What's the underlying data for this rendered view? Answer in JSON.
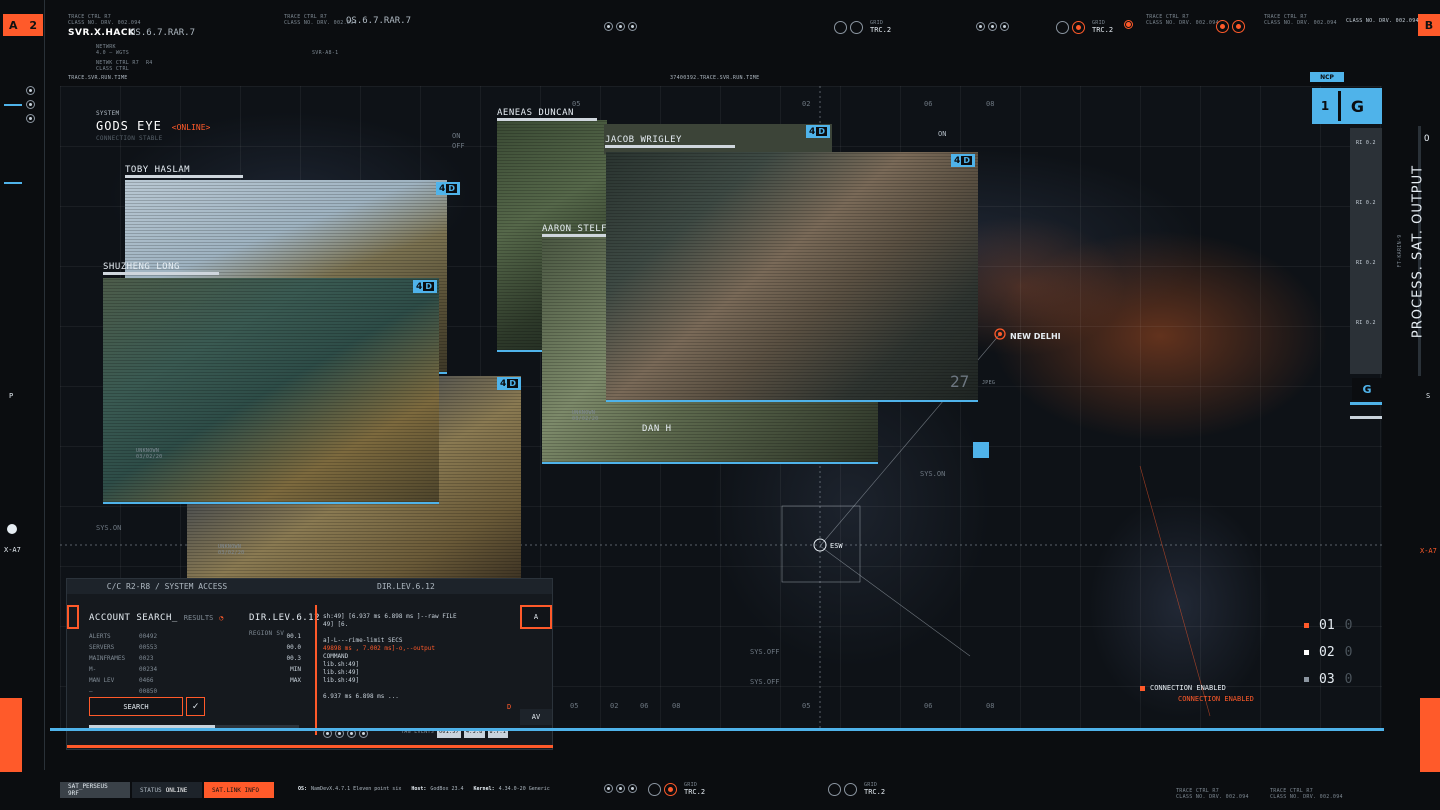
{
  "top": {
    "corner_left": {
      "letter": "A",
      "num": "2"
    },
    "corner_right": "B",
    "trace_label": "TRACE CTRL R7",
    "class_label": "CLASS NO. DRV. 002.094",
    "title": "SVR.X.HACK",
    "version": "OS.6.7.RAR.7",
    "version2": "OS.6.7.RAR.7",
    "network": "NETWRK",
    "network_val": "4.0 — WGTS",
    "netwrk_ctrl": "NETWK CTRL R7",
    "class_ctrl": "CLASS CTRL",
    "r4": "R4",
    "run_time_left": "TRACE.SVR.RUN.TIME",
    "run_time_center": "37400392.TRACE.SVR.RUN.TIME",
    "trc1": "TRC.2",
    "trc2": "TRC.2",
    "grid_label": "GRID",
    "code_tag": "SVR-A8-1"
  },
  "left_rail": {
    "p": "P",
    "xa7": "X-A7",
    "bottom_tag": "TRACE CTRL R7 CLASS NO. DRV. 002.094"
  },
  "right_rail": {
    "ncp": "NCP",
    "one": "1",
    "g": "G",
    "g2": "G",
    "ri": [
      "RI 0.2",
      "RI 0.2",
      "RI 0.2",
      "RI 0.2"
    ],
    "vertical": "PROCESS. SAT. OUTPUT",
    "vertical_small": "FT-KARIN-9",
    "s": "S",
    "xa7": "X-A7",
    "o": "O"
  },
  "system": {
    "label": "SYSTEM",
    "name": "GODS EYE",
    "status": "<ONLINE>",
    "conn": "CONNECTION STABLE"
  },
  "people": [
    {
      "name": "TOBY HASLAM",
      "n": "4",
      "d": "D"
    },
    {
      "name": "SHUZHENG LONG",
      "n": "4",
      "d": "D"
    },
    {
      "name": "AENEAS DUNCAN",
      "n": "4",
      "d": "D"
    },
    {
      "name": "JACOB WRIGLEY",
      "n": "4",
      "d": "D"
    },
    {
      "name": "AARON STELFOX",
      "n": "4",
      "d": "D"
    },
    {
      "name": "DAN H",
      "n": "4",
      "d": "D"
    }
  ],
  "map": {
    "city": "NEW DELHI",
    "esw": "ESW",
    "sys_on": "SYS.ON",
    "sys_off": "SYS.OFF",
    "on": "ON",
    "off": "OFF",
    "top_ticks": [
      "05",
      "02",
      "06",
      "08"
    ],
    "bottom_ticks": [
      "05",
      "02",
      "06",
      "08",
      "05",
      "06",
      "08"
    ],
    "number_27": "27",
    "jpeg": "JPEG",
    "unknown": "UNKNOWN",
    "date": "03/02/20",
    "conn_enabled": "CONNECTION ENABLED",
    "conn_enabled2": "CONNECTION ENABLED"
  },
  "legend": [
    {
      "num": "01",
      "ghost": "0"
    },
    {
      "num": "02",
      "ghost": "0"
    },
    {
      "num": "03",
      "ghost": "0"
    }
  ],
  "search": {
    "tab1": "C/C R2-R8 / SYSTEM ACCESS",
    "tab2": "DIR.LEV.6.12",
    "title": "ACCOUNT SEARCH_",
    "results": "RESULTS",
    "dir": "DIR.LEV.6.12",
    "region": "REGION SV",
    "stats": [
      {
        "k": "ALERTS",
        "m": "00492",
        "v": "00.1"
      },
      {
        "k": "SERVERS",
        "m": "00553",
        "v": "00.0"
      },
      {
        "k": "MAINFRAMES",
        "m": "0023",
        "v": "00.3"
      },
      {
        "k": "M-",
        "m": "00234",
        "v": "MIN"
      },
      {
        "k": "MAN LEV",
        "m": "0466",
        "v": "MAX"
      },
      {
        "k": "—",
        "m": "00850",
        "v": ""
      }
    ],
    "button": "SEARCH",
    "check": "✓",
    "log": [
      "sh:49] [6.937 ms 6.898 ms ]--raw FILE",
      "49] [6.",
      "",
      "a]-L---rime-limit SECS",
      "49898 ms , 7.002 ms]-o,--output",
      "COMMAND",
      "lib.sh:49]",
      "lib.sh:49]",
      "lib.sh:49]",
      "",
      "6.937 ms 6.898 ms ..."
    ],
    "side_a": "A",
    "side_av": "AV",
    "side_d": "D",
    "footer_tags": [
      "TAG EVENTS",
      "001.57",
      "4.3.8",
      "8.7.1"
    ]
  },
  "bottom": {
    "tab1": "SAT_PERSEUS 9RF",
    "tab2_k": "STATUS",
    "tab2_v": "ONLINE",
    "tab3": "SAT.LINK INFO",
    "os_k": "OS:",
    "os_v": "NamDevX.4.7.1 Eleven point six",
    "host_k": "Host:",
    "host_v": "GodBox 23.4",
    "kernel_k": "Kernel:",
    "kernel_v": "4.34.0-20 Generic",
    "trc1": "TRC.2",
    "trc2": "TRC.2",
    "grid": "GRID",
    "trace": "TRACE CTRL R7",
    "class": "CLASS NO. DRV. 002.094"
  }
}
